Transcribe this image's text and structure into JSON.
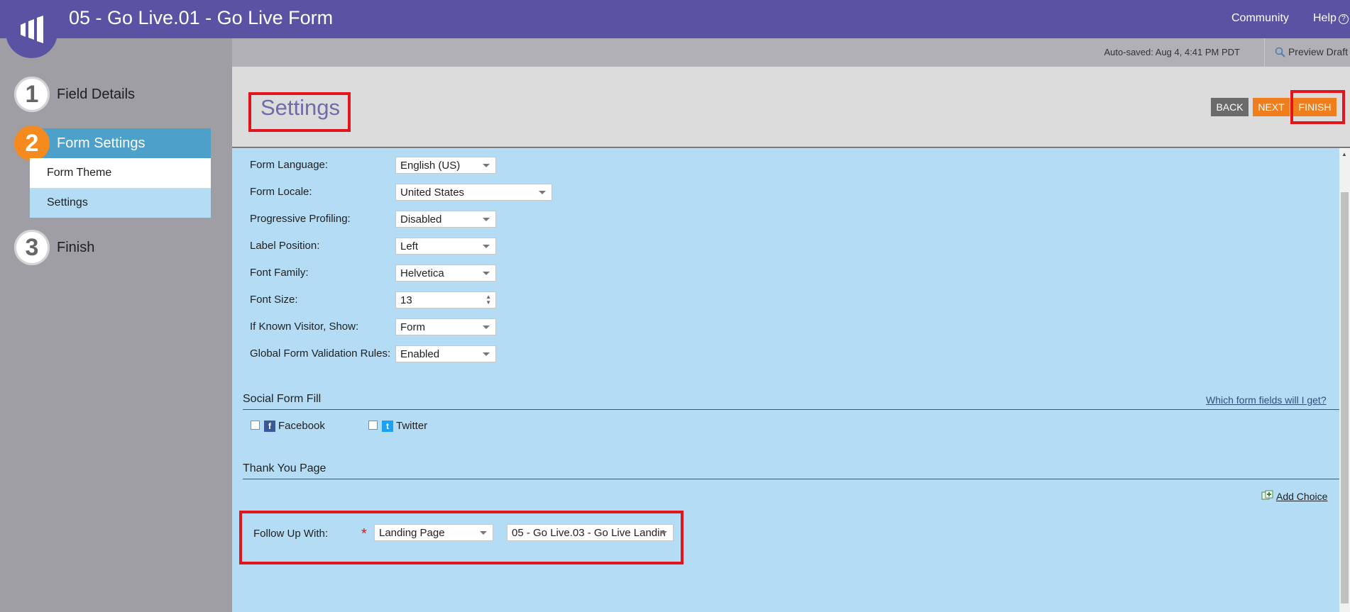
{
  "header": {
    "title": "05 - Go Live.01 - Go Live Form",
    "community_label": "Community",
    "help_label": "Help",
    "help_icon_glyph": "?"
  },
  "sidebar": {
    "steps": [
      {
        "number": "1",
        "label": "Field Details"
      },
      {
        "number": "2",
        "label": "Form Settings"
      },
      {
        "number": "3",
        "label": "Finish"
      }
    ],
    "substeps": [
      {
        "label": "Form Theme"
      },
      {
        "label": "Settings"
      }
    ]
  },
  "toolbar": {
    "autosaved": "Auto-saved: Aug 4, 4:41 PM PDT",
    "preview_label": "Preview Draft"
  },
  "settings": {
    "title": "Settings",
    "back_label": "BACK",
    "next_label": "NEXT",
    "finish_label": "FINISH"
  },
  "form_fields": [
    {
      "label": "Form Language:",
      "value": "English (US)"
    },
    {
      "label": "Form Locale:",
      "value": "United States"
    },
    {
      "label": "Progressive Profiling:",
      "value": "Disabled"
    },
    {
      "label": "Label Position:",
      "value": "Left"
    },
    {
      "label": "Font Family:",
      "value": "Helvetica"
    },
    {
      "label": "Font Size:",
      "value": "13"
    },
    {
      "label": "If Known Visitor, Show:",
      "value": "Form"
    },
    {
      "label": "Global Form Validation Rules:",
      "value": "Enabled"
    }
  ],
  "social": {
    "title": "Social Form Fill",
    "link": "Which form fields will I get?",
    "facebook_label": "Facebook",
    "twitter_label": "Twitter",
    "facebook_glyph": "f",
    "twitter_glyph": "t"
  },
  "thank_you": {
    "title": "Thank You Page",
    "add_choice_label": "Add Choice",
    "follow_up_label": "Follow Up With:",
    "required_mark": "*",
    "follow_up_type": "Landing Page",
    "follow_up_page": "05 - Go Live.03 - Go Live Landin"
  },
  "colors": {
    "header": "#5a53a3",
    "accent_orange": "#f07e1c",
    "active_step": "#4ca0c9",
    "content_bg": "#b4ddf5",
    "highlight": "#e2141c"
  }
}
